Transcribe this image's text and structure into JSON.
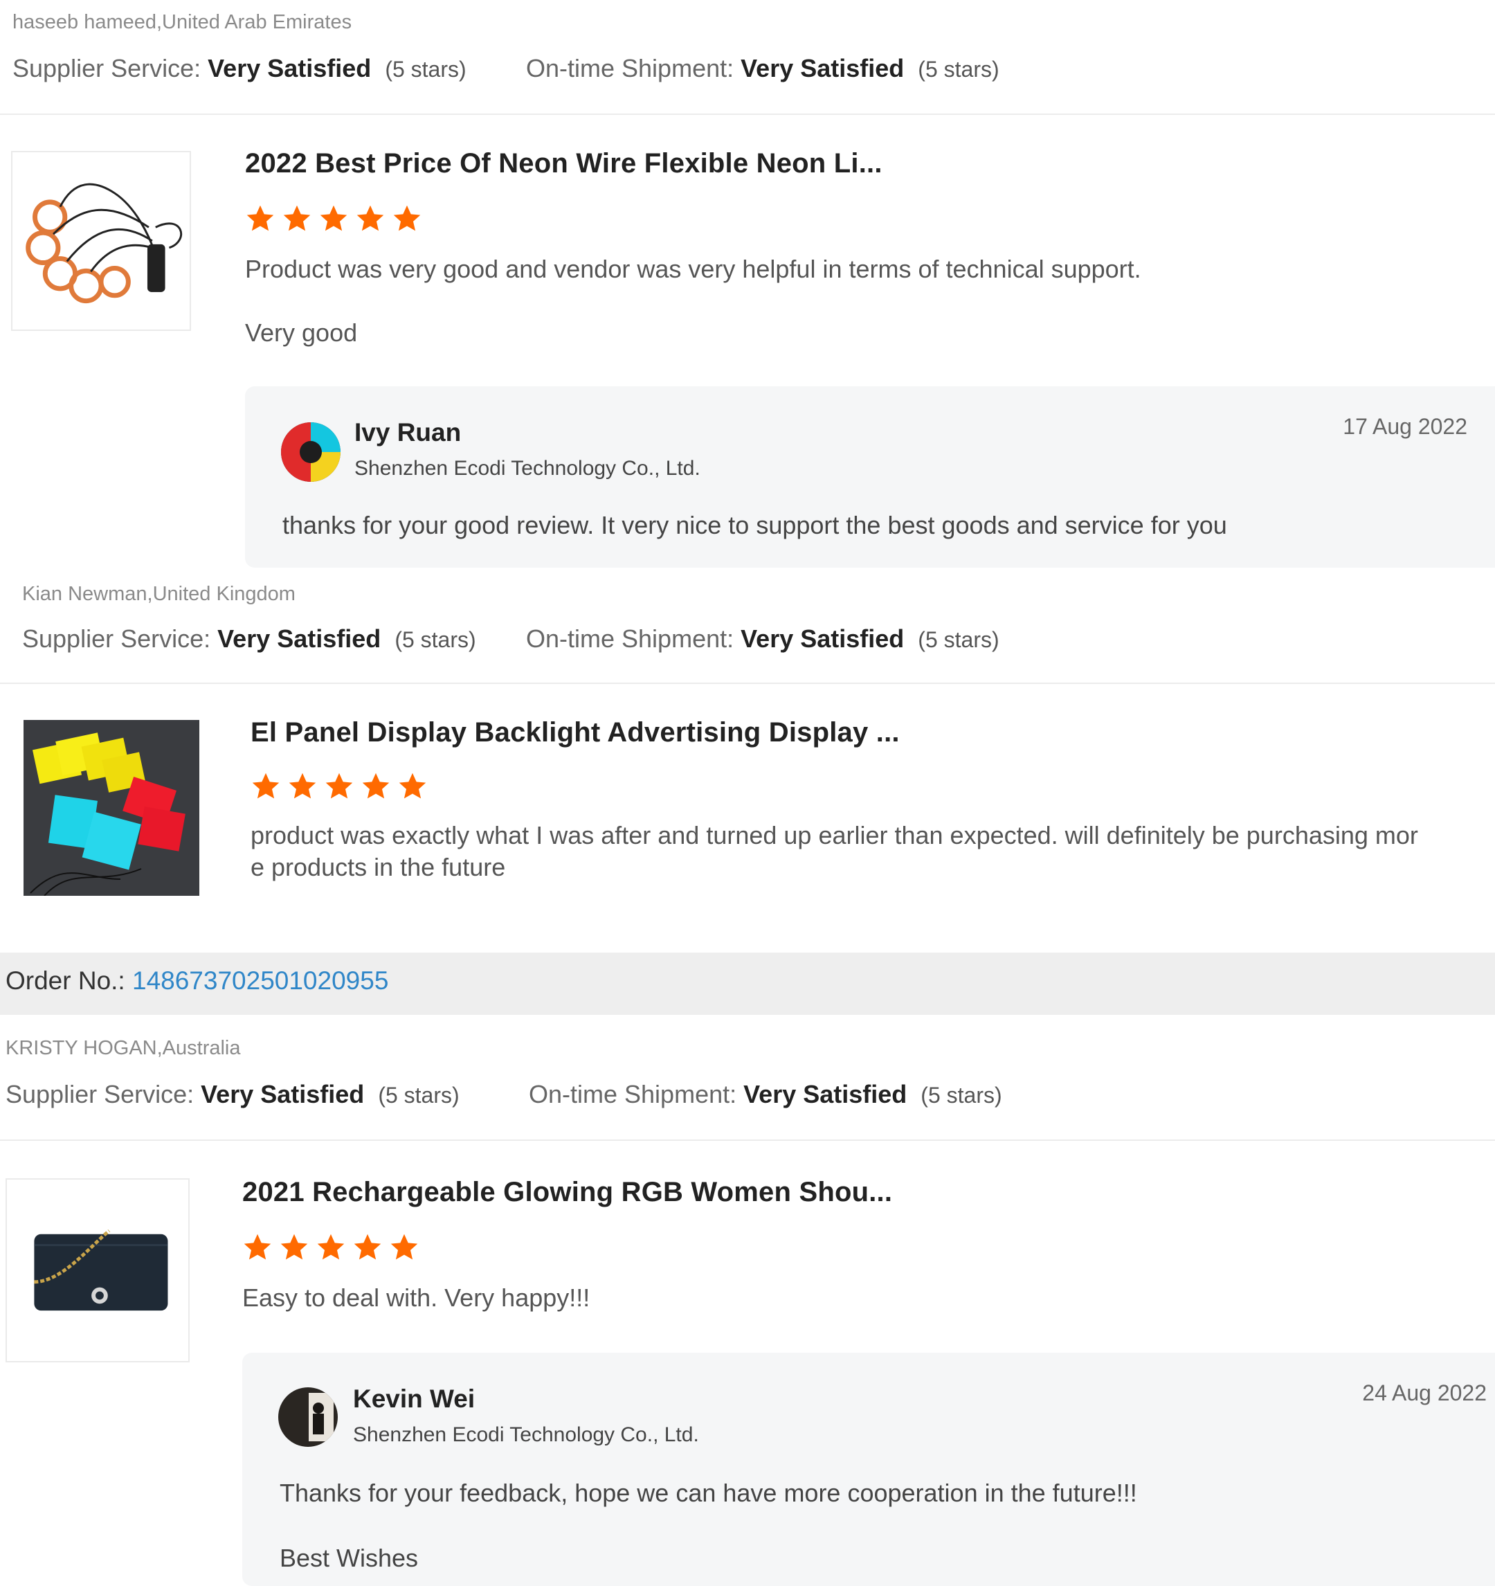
{
  "colors": {
    "star": "#ff6a00",
    "link": "#2f86c8",
    "reply_bg": "#f5f6f7",
    "order_bg": "#eeeeee"
  },
  "reviews": [
    {
      "buyer": "haseeb hameed,United Arab Emirates",
      "supplier_label": "Supplier Service:",
      "supplier_value": "Very Satisfied",
      "supplier_stars": "(5 stars)",
      "shipment_label": "On-time Shipment:",
      "shipment_value": "Very Satisfied",
      "shipment_stars": "(5 stars)",
      "product_title": "2022 Best Price Of Neon Wire Flexible Neon Li...",
      "rating": 5,
      "text1": "Product was very good and vendor was very helpful in terms of technical support.",
      "text2": "Very good",
      "reply": {
        "name": "Ivy Ruan",
        "company": "Shenzhen Ecodi Technology Co., Ltd.",
        "date": "17 Aug 2022",
        "text": "thanks for your good review. It very nice to support the best goods and service for you"
      }
    },
    {
      "buyer": "Kian Newman,United Kingdom",
      "supplier_label": "Supplier Service:",
      "supplier_value": "Very Satisfied",
      "supplier_stars": "(5 stars)",
      "shipment_label": "On-time Shipment:",
      "shipment_value": "Very Satisfied",
      "shipment_stars": "(5 stars)",
      "product_title": "El Panel Display Backlight Advertising Display ...",
      "rating": 5,
      "text1": "product was exactly what I was after and turned up earlier than expected. will definitely be purchasing mor",
      "text1b": "e products in the future"
    },
    {
      "order_label": "Order No.:",
      "order_number": "148673702501020955",
      "buyer": "KRISTY HOGAN,Australia",
      "supplier_label": "Supplier Service:",
      "supplier_value": "Very Satisfied",
      "supplier_stars": "(5 stars)",
      "shipment_label": "On-time Shipment:",
      "shipment_value": "Very Satisfied",
      "shipment_stars": "(5 stars)",
      "product_title": "2021 Rechargeable Glowing RGB Women Shou...",
      "rating": 5,
      "text1": "Easy to deal with. Very happy!!!",
      "reply": {
        "name": "Kevin Wei",
        "company": "Shenzhen Ecodi Technology Co., Ltd.",
        "date": "24 Aug 2022",
        "text": "Thanks for your feedback, hope we can have more cooperation in the future!!!",
        "text2": "Best Wishes"
      }
    }
  ]
}
